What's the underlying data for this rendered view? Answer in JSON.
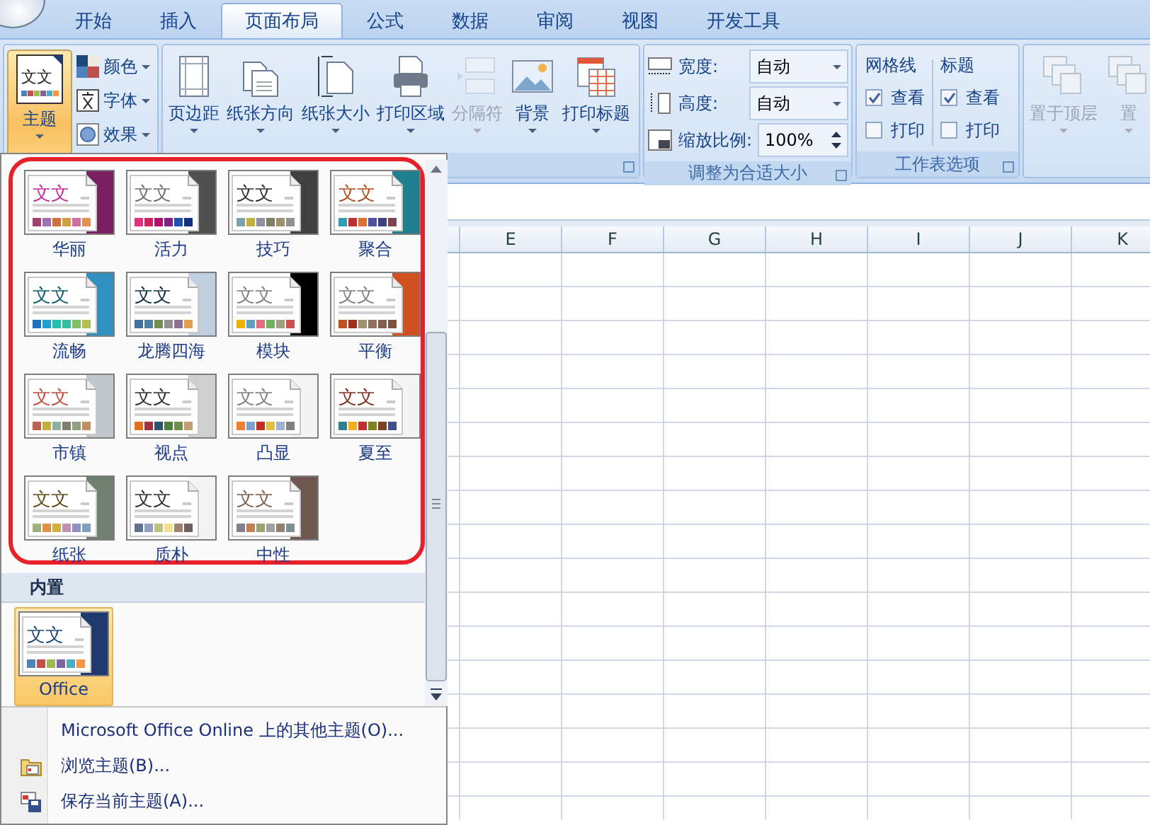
{
  "tabs": [
    {
      "label": "开始",
      "selected": false
    },
    {
      "label": "插入",
      "selected": false
    },
    {
      "label": "页面布局",
      "selected": true
    },
    {
      "label": "公式",
      "selected": false
    },
    {
      "label": "数据",
      "selected": false
    },
    {
      "label": "审阅",
      "selected": false
    },
    {
      "label": "视图",
      "selected": false
    },
    {
      "label": "开发工具",
      "selected": false
    }
  ],
  "themes_group": {
    "main_button": {
      "label": "主题",
      "sample": "文文",
      "active": true
    },
    "small_buttons": [
      {
        "label": "颜色"
      },
      {
        "label": "字体"
      },
      {
        "label": "效果"
      }
    ]
  },
  "page_setup": {
    "buttons": [
      {
        "label": "页边距",
        "disabled": false
      },
      {
        "label": "纸张方向",
        "disabled": false
      },
      {
        "label": "纸张大小",
        "disabled": false
      },
      {
        "label": "打印区域",
        "disabled": false
      },
      {
        "label": "分隔符",
        "disabled": true
      },
      {
        "label": "背景",
        "disabled": false
      },
      {
        "label": "打印标题",
        "disabled": false
      }
    ]
  },
  "scale_group": {
    "title": "调整为合适大小",
    "fields": [
      {
        "label": "宽度:",
        "value": "自动",
        "kind": "dropdown"
      },
      {
        "label": "高度:",
        "value": "自动",
        "kind": "dropdown"
      },
      {
        "label": "缩放比例:",
        "value": "100%",
        "kind": "spinner"
      }
    ]
  },
  "sheet_options": {
    "title": "工作表选项",
    "columns": [
      {
        "title": "网格线",
        "options": [
          {
            "label": "查看",
            "checked": true
          },
          {
            "label": "打印",
            "checked": false
          }
        ]
      },
      {
        "title": "标题",
        "options": [
          {
            "label": "查看",
            "checked": true
          },
          {
            "label": "打印",
            "checked": false
          }
        ]
      }
    ]
  },
  "arrange_group": {
    "buttons": [
      {
        "label": "置于顶层",
        "disabled": true
      },
      {
        "label": "置",
        "disabled": true
      }
    ]
  },
  "columns": [
    "E",
    "F",
    "G",
    "H",
    "I",
    "J",
    "K"
  ],
  "theme_menu": {
    "custom_themes": [
      {
        "name": "华丽",
        "sample": "文文",
        "selected": false
      },
      {
        "name": "活力",
        "sample": "文文",
        "selected": false
      },
      {
        "name": "技巧",
        "sample": "文文",
        "selected": false
      },
      {
        "name": "聚合",
        "sample": "文文",
        "selected": false
      },
      {
        "name": "流畅",
        "sample": "文文",
        "selected": false
      },
      {
        "name": "龙腾四海",
        "sample": "文文",
        "selected": false
      },
      {
        "name": "模块",
        "sample": "文文",
        "selected": false
      },
      {
        "name": "平衡",
        "sample": "文文",
        "selected": false
      },
      {
        "name": "市镇",
        "sample": "文文",
        "selected": false
      },
      {
        "name": "视点",
        "sample": "文文",
        "selected": false
      },
      {
        "name": "凸显",
        "sample": "文文",
        "selected": false
      },
      {
        "name": "夏至",
        "sample": "文文",
        "selected": false
      },
      {
        "name": "纸张",
        "sample": "文文",
        "selected": false
      },
      {
        "name": "质朴",
        "sample": "文文",
        "selected": false
      },
      {
        "name": "中性",
        "sample": "文文",
        "selected": false
      }
    ],
    "builtin_title": "内置",
    "builtin_themes": [
      {
        "name": "Office",
        "sample": "文文",
        "selected": true
      }
    ],
    "commands": [
      {
        "label": "Microsoft Office Online 上的其他主题(O)...",
        "kind": "plain"
      },
      {
        "label": "浏览主题(B)...",
        "kind": "browse"
      },
      {
        "label": "保存当前主题(A)...",
        "kind": "save"
      }
    ]
  }
}
